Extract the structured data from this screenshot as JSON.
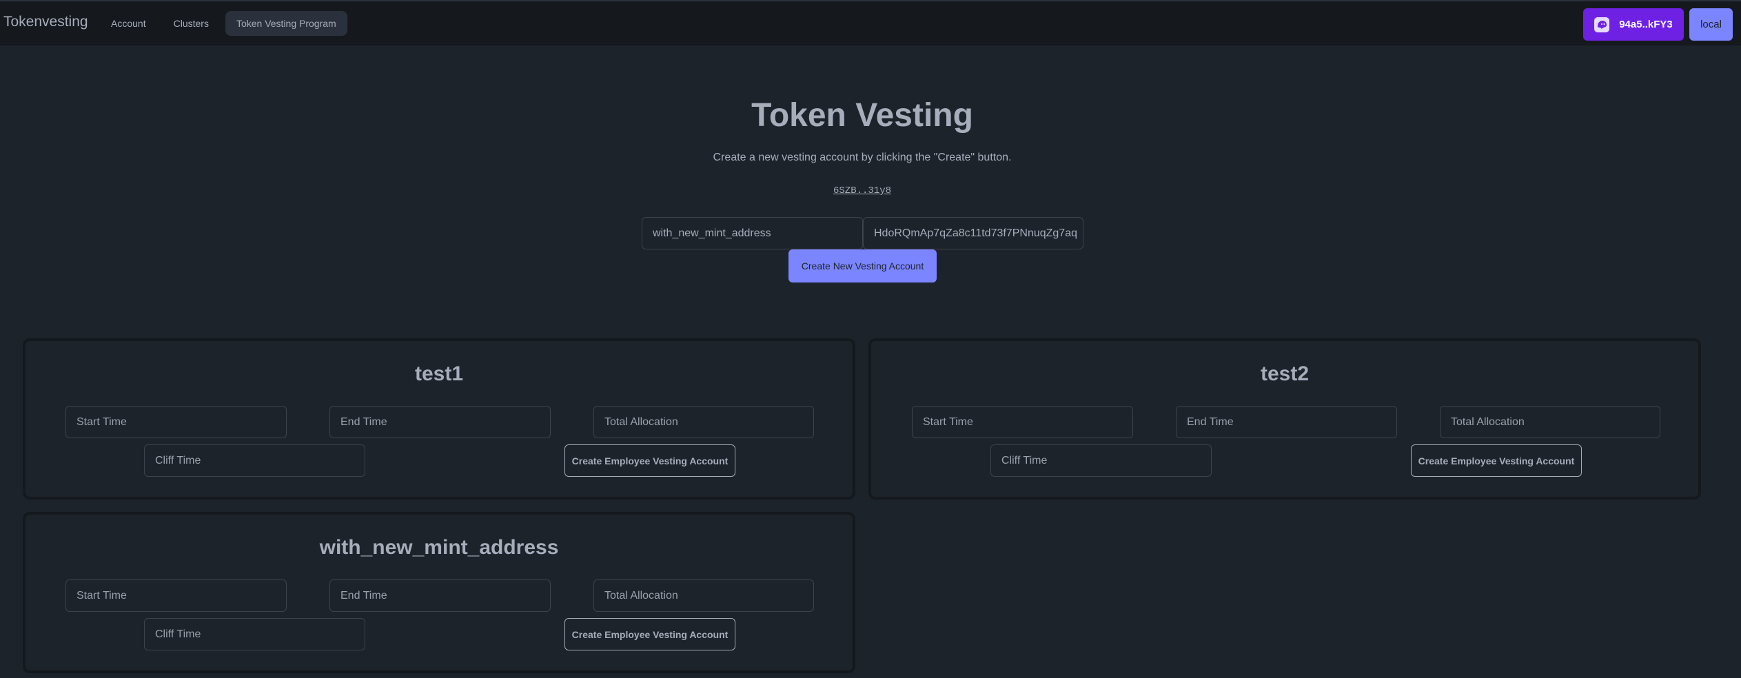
{
  "navbar": {
    "brand": "Tokenvesting",
    "links": [
      {
        "label": "Account"
      },
      {
        "label": "Clusters"
      },
      {
        "label": "Token Vesting Program"
      }
    ],
    "wallet": {
      "label": "94a5..kFY3",
      "color": "#6e21e3"
    },
    "cluster": {
      "label": "local",
      "color": "#7b85ff"
    }
  },
  "hero": {
    "title": "Token Vesting",
    "subtitle": "Create a new vesting account by clicking the \"Create\" button.",
    "program_link": "6SZB..31y8",
    "company_input": {
      "value": "with_new_mint_address"
    },
    "mint_input": {
      "value": "HdoRQmAp7qZa8c11td73f7PNnuqZg7aq"
    },
    "create_button": "Create New Vesting Account"
  },
  "cards": [
    {
      "title": "test1",
      "start_placeholder": "Start Time",
      "end_placeholder": "End Time",
      "allocation_placeholder": "Total Allocation",
      "cliff_placeholder": "Cliff Time",
      "button": "Create Employee Vesting Account"
    },
    {
      "title": "test2",
      "start_placeholder": "Start Time",
      "end_placeholder": "End Time",
      "allocation_placeholder": "Total Allocation",
      "cliff_placeholder": "Cliff Time",
      "button": "Create Employee Vesting Account"
    },
    {
      "title": "with_new_mint_address",
      "start_placeholder": "Start Time",
      "end_placeholder": "End Time",
      "allocation_placeholder": "Total Allocation",
      "cliff_placeholder": "Cliff Time",
      "button": "Create Employee Vesting Account"
    }
  ]
}
